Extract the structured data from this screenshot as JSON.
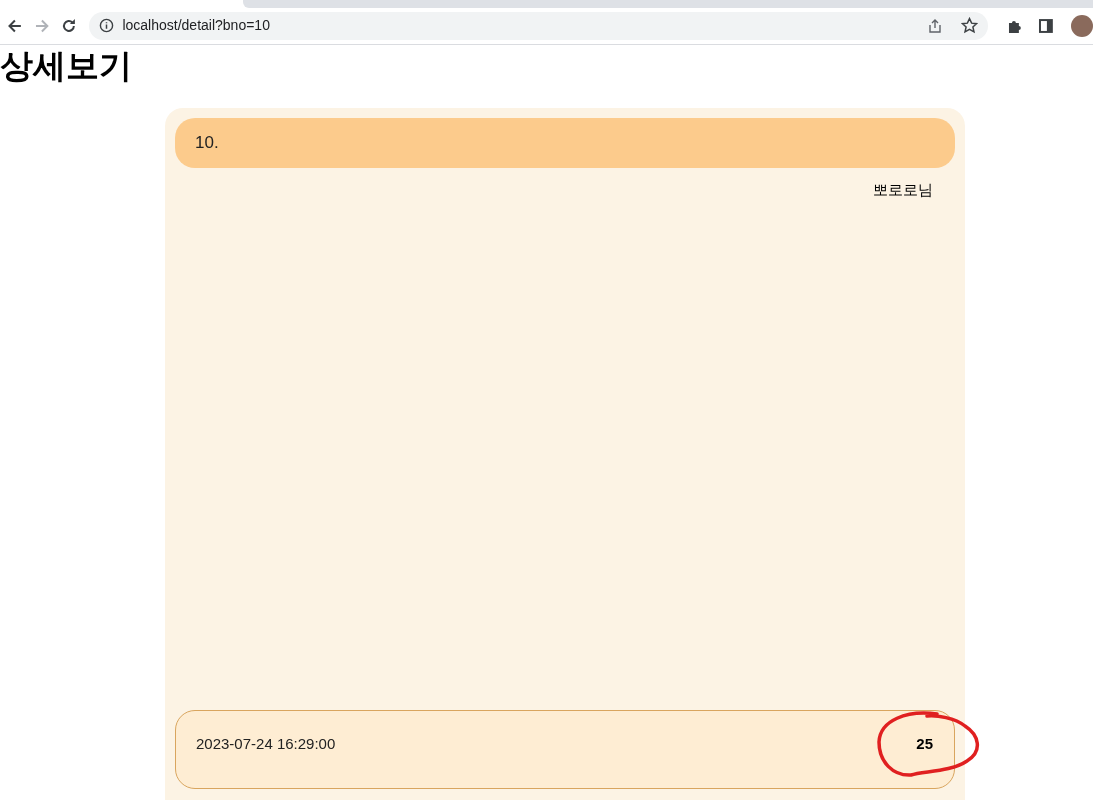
{
  "browser": {
    "url": "localhost/detail?bno=10",
    "forward_disabled": true
  },
  "page": {
    "heading": "상세보기"
  },
  "post": {
    "title": "10.",
    "author": "뽀로로님",
    "date": "2023-07-24 16:29:00",
    "count": "25",
    "count_circled": true
  }
}
